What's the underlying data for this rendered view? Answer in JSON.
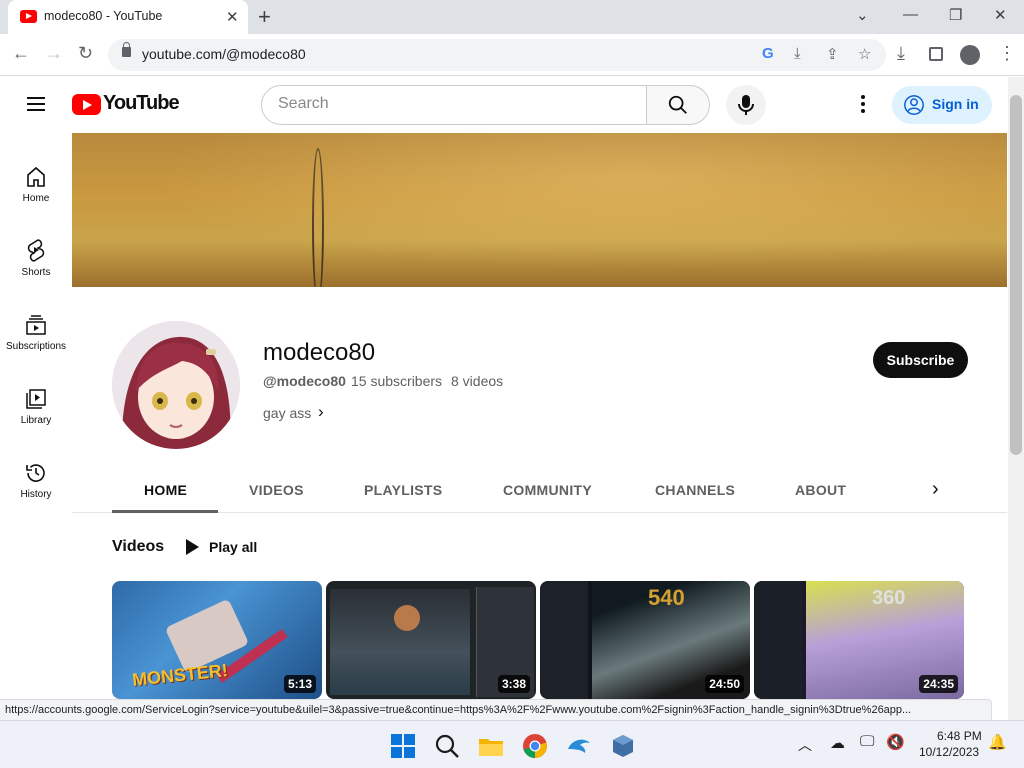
{
  "browser": {
    "tab_title": "modeco80 - YouTube",
    "url": "youtube.com/@modeco80",
    "status_url": "https://accounts.google.com/ServiceLogin?service=youtube&uilel=3&passive=true&continue=https%3A%2F%2Fwww.youtube.com%2Fsignin%3Faction_handle_signin%3Dtrue%26app..."
  },
  "header": {
    "logo": "YouTube",
    "search_placeholder": "Search",
    "signin_label": "Sign in"
  },
  "sidebar": {
    "items": [
      {
        "label": "Home",
        "icon": "home-icon"
      },
      {
        "label": "Shorts",
        "icon": "shorts-icon"
      },
      {
        "label": "Subscriptions",
        "icon": "subscriptions-icon"
      },
      {
        "label": "Library",
        "icon": "library-icon"
      },
      {
        "label": "History",
        "icon": "history-icon"
      }
    ]
  },
  "channel": {
    "name": "modeco80",
    "handle": "@modeco80",
    "subscribers": "15 subscribers",
    "videos": "8 videos",
    "description": "gay ass",
    "subscribe_label": "Subscribe"
  },
  "tabs": [
    "HOME",
    "VIDEOS",
    "PLAYLISTS",
    "COMMUNITY",
    "CHANNELS",
    "ABOUT"
  ],
  "shelf": {
    "title": "Videos",
    "play_all": "Play all",
    "videos": [
      {
        "duration": "5:13",
        "overlay": "MONSTER!"
      },
      {
        "duration": "3:38"
      },
      {
        "duration": "24:50"
      },
      {
        "duration": "24:35"
      }
    ]
  },
  "taskbar": {
    "time": "6:48 PM",
    "date": "10/12/2023"
  },
  "colors": {
    "brand_red": "#ff0000",
    "signin_bg": "#def1ff",
    "signin_text": "#065fd4"
  }
}
